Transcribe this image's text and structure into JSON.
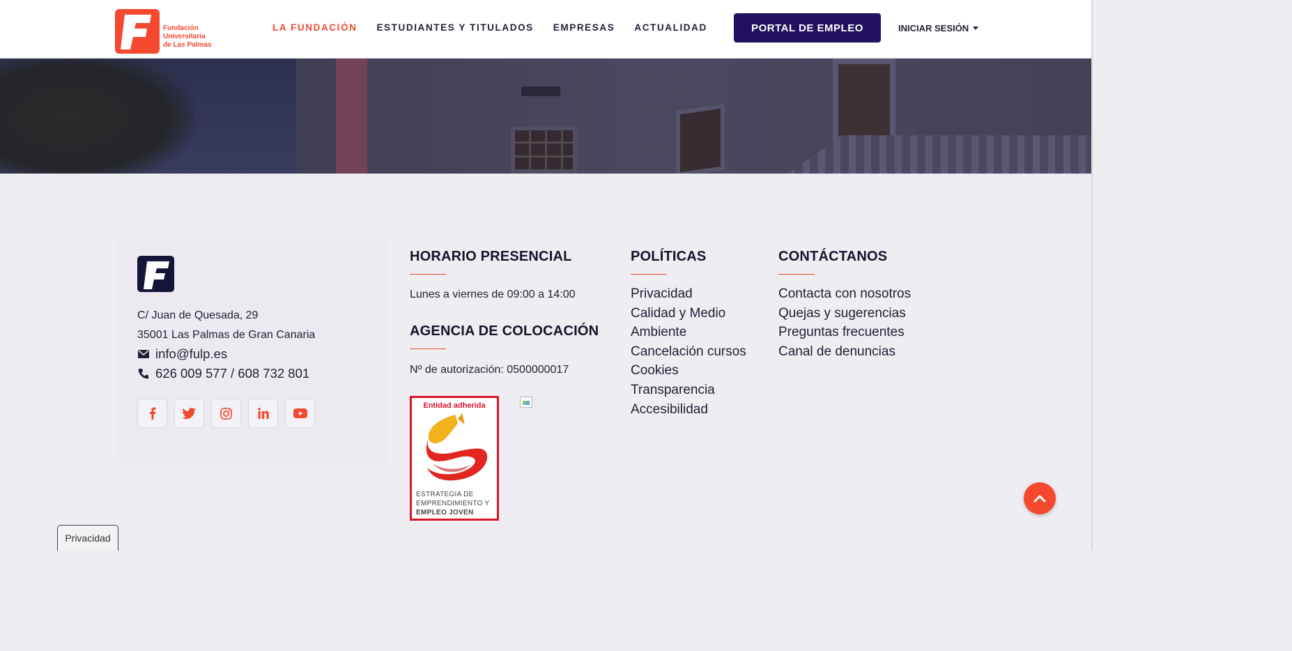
{
  "header": {
    "logo": {
      "line1": "Fundación",
      "line2": "Universitaria",
      "line3": "de Las Palmas"
    },
    "nav": [
      {
        "label": "LA FUNDACIÓN",
        "active": true
      },
      {
        "label": "ESTUDIANTES Y TITULADOS",
        "active": false
      },
      {
        "label": "EMPRESAS",
        "active": false
      },
      {
        "label": "ACTUALIDAD",
        "active": false
      }
    ],
    "portal_button": "PORTAL DE EMPLEO",
    "login": "INICIAR SESIÓN"
  },
  "footer": {
    "address_line1": "C/ Juan de Quesada, 29",
    "address_line2": "35001 Las Palmas de Gran Canaria",
    "email": "info@fulp.es",
    "phone": "626 009 577 / 608 732 801",
    "socials": [
      "facebook-icon",
      "twitter-icon",
      "instagram-icon",
      "linkedin-icon",
      "youtube-icon"
    ],
    "schedule": {
      "title": "HORARIO PRESENCIAL",
      "text": "Lunes a viernes de 09:00 a 14:00"
    },
    "agency": {
      "title": "AGENCIA DE COLOCACIÓN",
      "text": "Nº de autorización: 0500000017"
    },
    "badge": {
      "top": "Entidad adherida",
      "line1": "ESTRATEGIA DE",
      "line2": "EMPRENDIMIENTO Y",
      "line3": "EMPLEO JOVEN"
    },
    "policies": {
      "title": "POLÍTICAS",
      "links": [
        "Privacidad",
        "Calidad y Medio",
        "Ambiente",
        "Cancelación cursos",
        "Cookies",
        "Transparencia",
        "Accesibilidad"
      ]
    },
    "contact": {
      "title": "CONTÁCTANOS",
      "links": [
        "Contacta con nosotros",
        "Quejas y sugerencias",
        "Preguntas frecuentes",
        "Canal de denuncias"
      ]
    }
  },
  "privacy_tab": "Privacidad",
  "colors": {
    "accent": "#f4492f",
    "primary": "#22115e",
    "footer_bg": "#eeedf2"
  }
}
